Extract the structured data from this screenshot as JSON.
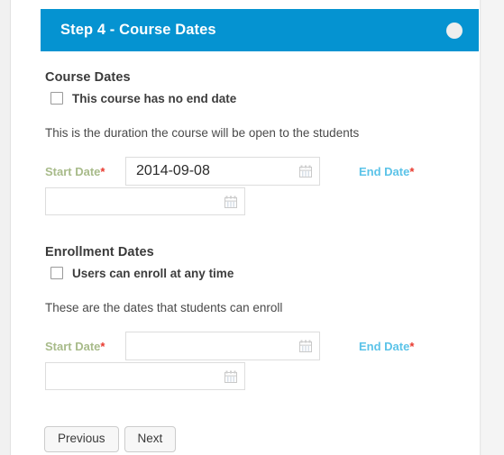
{
  "banner": {
    "title": "Step 4 - Course Dates",
    "indicator_icon": "circle-step-indicator",
    "background_color": "#0593d1",
    "indicator_color": "#eeeeee"
  },
  "sections": [
    {
      "heading": "Course Dates",
      "checkbox_label": "This course has no end date",
      "checkbox_checked": false,
      "description": "This is the duration the course will be open to the students",
      "start_label": "Start Date",
      "end_label": "End Date",
      "required_marker": "*",
      "start_value": "2014-09-08",
      "end_value": "",
      "calendar_icon": "calendar-icon"
    },
    {
      "heading": "Enrollment Dates",
      "checkbox_label": "Users can enroll at any time",
      "checkbox_checked": false,
      "description": "These are the dates that students can enroll",
      "start_label": "Start Date",
      "end_label": "End Date",
      "required_marker": "*",
      "start_value": "",
      "end_value": "",
      "calendar_icon": "calendar-icon"
    }
  ],
  "buttons": {
    "previous_label": "Previous",
    "next_label": "Next"
  },
  "colors": {
    "banner_blue": "#0593d1",
    "start_label_green": "#a8bb8a",
    "end_label_blue": "#5bc3e8",
    "required_red": "#e8392e"
  }
}
